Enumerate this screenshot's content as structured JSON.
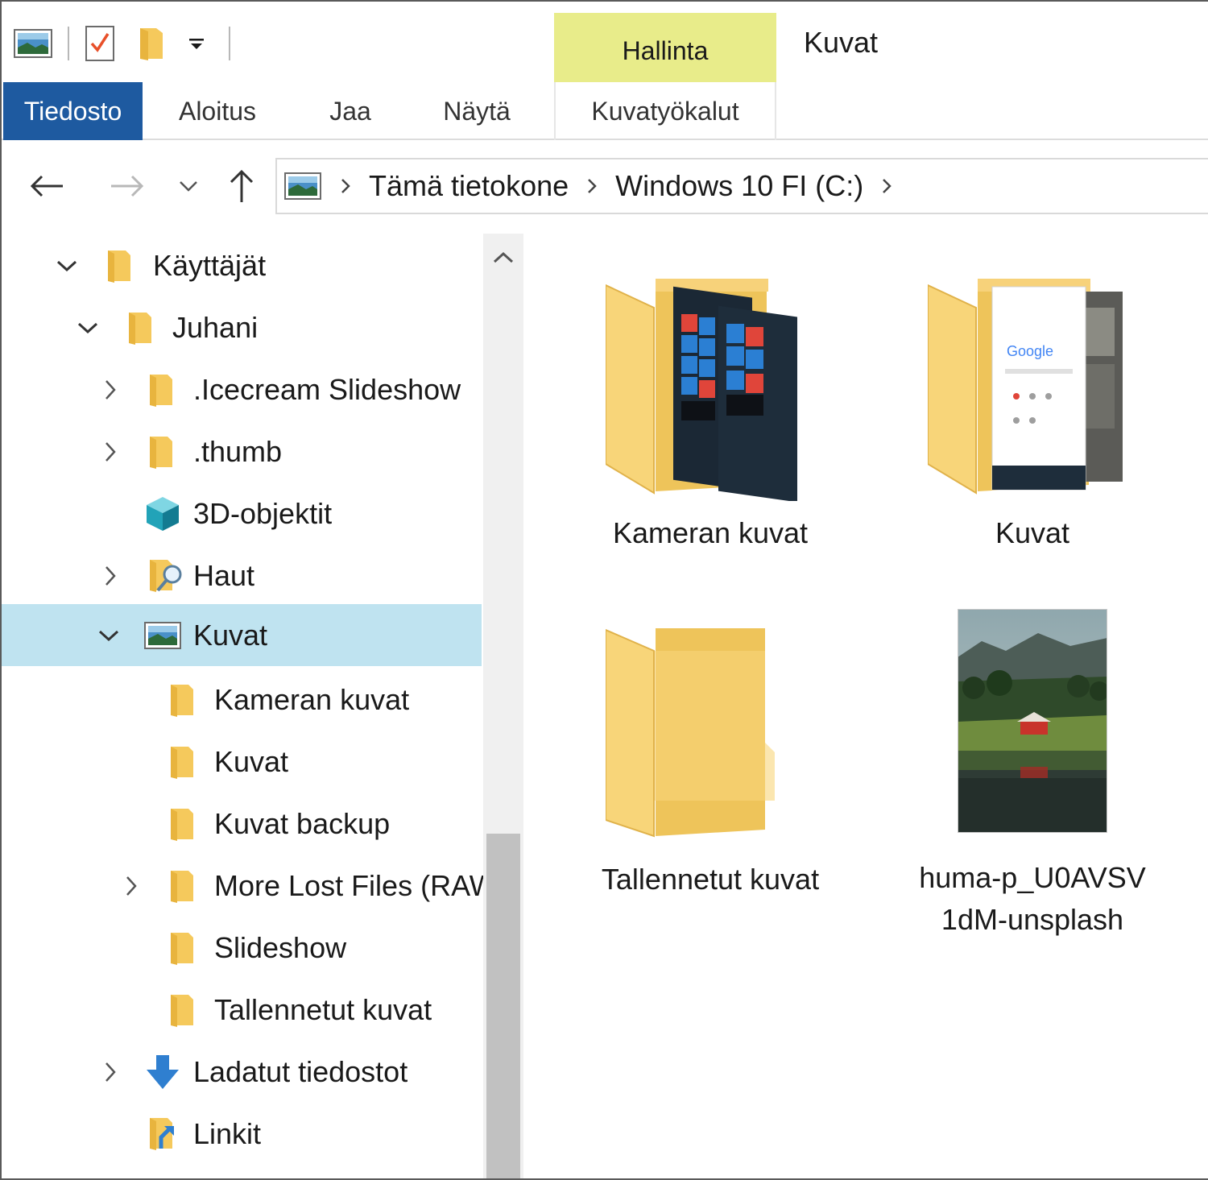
{
  "window": {
    "title": "Kuvat",
    "context_tab_group": "Hallinta"
  },
  "ribbon": {
    "tabs": [
      {
        "label": "Tiedosto"
      },
      {
        "label": "Aloitus"
      },
      {
        "label": "Jaa"
      },
      {
        "label": "Näytä"
      },
      {
        "label": "Kuvatyökalut"
      }
    ]
  },
  "address_bar": {
    "breadcrumbs": [
      "Tämä tietokone",
      "Windows 10 FI (C:)"
    ]
  },
  "tree": {
    "items": [
      {
        "label": "Käyttäjät",
        "icon": "folder-icon",
        "expander": "expanded"
      },
      {
        "label": "Juhani",
        "icon": "folder-icon",
        "expander": "expanded"
      },
      {
        "label": ".Icecream Slideshow",
        "icon": "folder-icon",
        "expander": "collapsed"
      },
      {
        "label": ".thumb",
        "icon": "folder-icon",
        "expander": "collapsed"
      },
      {
        "label": "3D-objektit",
        "icon": "3d-objects-icon",
        "expander": "none"
      },
      {
        "label": "Haut",
        "icon": "search-folder-icon",
        "expander": "collapsed"
      },
      {
        "label": "Kuvat",
        "icon": "pictures-icon",
        "expander": "expanded",
        "selected": true
      },
      {
        "label": "Kameran kuvat",
        "icon": "folder-icon",
        "expander": "none"
      },
      {
        "label": "Kuvat",
        "icon": "folder-icon",
        "expander": "none"
      },
      {
        "label": "Kuvat backup",
        "icon": "folder-icon",
        "expander": "none"
      },
      {
        "label": "More Lost Files (RAW)",
        "icon": "folder-icon",
        "expander": "collapsed"
      },
      {
        "label": "Slideshow",
        "icon": "folder-icon",
        "expander": "none"
      },
      {
        "label": "Tallennetut kuvat",
        "icon": "folder-icon",
        "expander": "none"
      },
      {
        "label": "Ladatut tiedostot",
        "icon": "download-icon",
        "expander": "collapsed"
      },
      {
        "label": "Linkit",
        "icon": "links-folder-icon",
        "expander": "none"
      }
    ]
  },
  "content": {
    "items": [
      {
        "name": "Kameran kuvat",
        "type": "folder-with-thumbnails"
      },
      {
        "name": "Kuvat",
        "type": "folder-with-thumbnails"
      },
      {
        "name": "Tallennetut kuvat",
        "type": "empty-folder"
      },
      {
        "name_line1": "huma-p_U0AVSV",
        "name_line2": "1dM-unsplash",
        "type": "image-file"
      }
    ]
  },
  "colors": {
    "file_tab": "#1e5aa0",
    "context_tab": "#e8ec8a",
    "selection": "#bfe3f0",
    "folder": "#f5c95c"
  }
}
